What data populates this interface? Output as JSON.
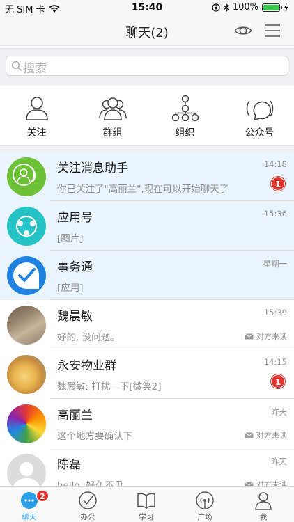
{
  "status_bar": {
    "carrier": "无 SIM 卡",
    "time": "15:40",
    "battery": "100%",
    "battery_level": 1.0
  },
  "nav": {
    "title": "聊天(2)",
    "eye_icon": "eye-icon",
    "menu_icon": "hamburger-menu-icon"
  },
  "search": {
    "placeholder": "搜索"
  },
  "quick_actions": [
    {
      "label": "关注",
      "icon": "person-icon"
    },
    {
      "label": "群组",
      "icon": "group-icon"
    },
    {
      "label": "组织",
      "icon": "org-tree-icon"
    },
    {
      "label": "公众号",
      "icon": "broadcast-icon"
    }
  ],
  "colors": {
    "accent": "#2a9ee8",
    "pinned_bg": "#e9f4fc",
    "badge_red": "#e0322c",
    "green_avatar": "#6cc136",
    "teal_avatar": "#25c3c6",
    "blue_avatar": "#1f82e0"
  },
  "chats": [
    {
      "name": "关注消息助手",
      "message": "你已关注了\"高丽兰\",现在可以开始聊天了",
      "time": "14:18",
      "unread": "1",
      "pinned": true
    },
    {
      "name": "应用号",
      "message": "[图片]",
      "time": "15:36",
      "pinned": true
    },
    {
      "name": "事务通",
      "message": "[应用]",
      "time": "星期一",
      "pinned": true
    },
    {
      "name": "魏晨敏",
      "message": "好的, 没问题。",
      "time": "15:39",
      "read_status": "对方未读",
      "pinned": false
    },
    {
      "name": "永安物业群",
      "message": "魏晨敏: 打扰一下[微笑2]",
      "time": "14:15",
      "unread": "1",
      "pinned": false
    },
    {
      "name": "高丽兰",
      "message": "这个地方要确认下",
      "time": "昨天",
      "read_status": "对方未读",
      "pinned": false
    },
    {
      "name": "陈磊",
      "message": "hello, 好久不见",
      "time": "昨天",
      "read_status": "对方未读",
      "pinned": false
    }
  ],
  "tabs": [
    {
      "label": "聊天",
      "icon": "chat-bubble-icon",
      "badge": "2",
      "active": true
    },
    {
      "label": "办公",
      "icon": "checkmark-circle-icon"
    },
    {
      "label": "学习",
      "icon": "open-book-icon"
    },
    {
      "label": "广场",
      "icon": "antenna-icon"
    },
    {
      "label": "我",
      "icon": "profile-icon"
    }
  ]
}
